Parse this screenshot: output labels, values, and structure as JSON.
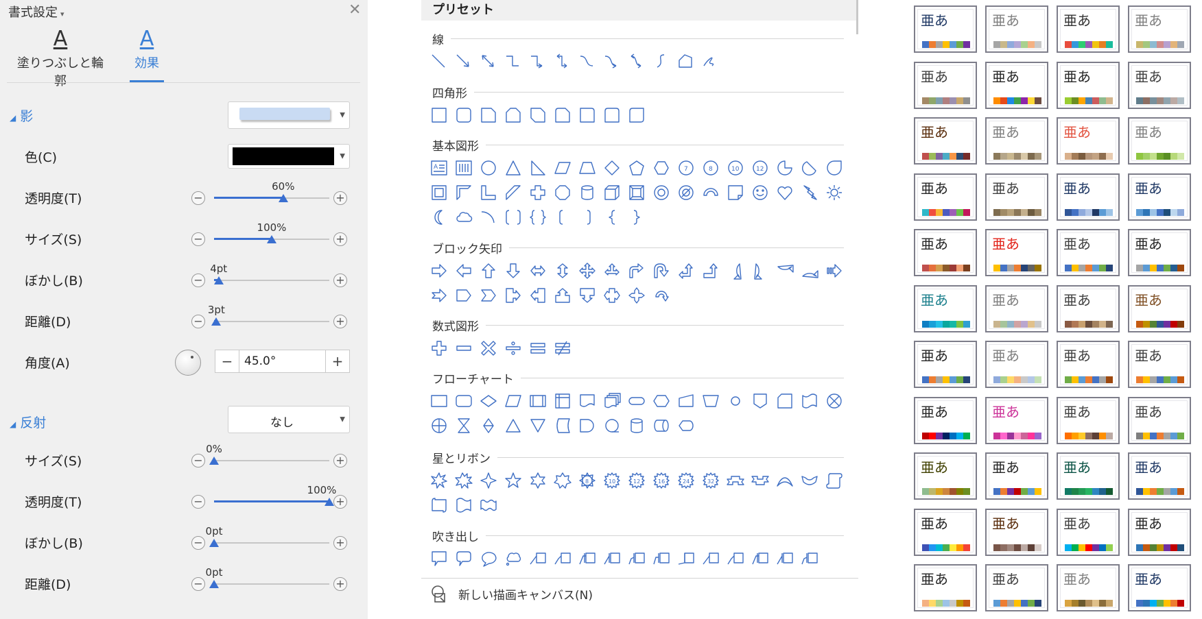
{
  "format_panel": {
    "title": "書式設定",
    "tabs": [
      {
        "icon": "A",
        "label": "塗りつぶしと輪郭"
      },
      {
        "icon": "A",
        "label": "効果"
      }
    ],
    "shadow": {
      "header": "影",
      "preset_color": "#c9dbf3",
      "color_label": "色(C)",
      "color_value": "#000000",
      "transparency": {
        "label": "透明度(T)",
        "value": "60%",
        "level": 0.6
      },
      "size": {
        "label": "サイズ(S)",
        "value": "100%",
        "level": 0.5
      },
      "blur": {
        "label": "ぼかし(B)",
        "value": "4pt",
        "level": 0.04
      },
      "distance": {
        "label": "距離(D)",
        "value": "3pt",
        "level": 0.02
      },
      "angle": {
        "label": "角度(A)",
        "value": "45.0°",
        "minus": "−",
        "plus": "+"
      }
    },
    "reflection": {
      "header": "反射",
      "preset_value": "なし",
      "size": {
        "label": "サイズ(S)",
        "value": "0%",
        "level": 0.0
      },
      "transparency": {
        "label": "透明度(T)",
        "value": "100%",
        "level": 1.0
      },
      "blur": {
        "label": "ぼかし(B)",
        "value": "0pt",
        "level": 0.0
      },
      "distance": {
        "label": "距離(D)",
        "value": "0pt",
        "level": 0.0
      }
    }
  },
  "preset": {
    "title": "プリセット",
    "categories": [
      {
        "label": "線",
        "count": 12
      },
      {
        "label": "四角形",
        "count": 9
      },
      {
        "label": "基本図形",
        "count": 43
      },
      {
        "label": "ブロック矢印",
        "count": 27
      },
      {
        "label": "数式図形",
        "count": 6
      },
      {
        "label": "フローチャート",
        "count": 28
      },
      {
        "label": "星とリボン",
        "count": 19
      },
      {
        "label": "吹き出し",
        "count": 16
      }
    ],
    "new_canvas": "新しい描画キャンバス(N)"
  },
  "themes": {
    "sample_text": "亜あ",
    "swatches": [
      {
        "text": "#1f3864",
        "colors": [
          "#4472c4",
          "#ed7d31",
          "#a5a5a5",
          "#ffc000",
          "#5b9bd5",
          "#70ad47",
          "#7030a0"
        ]
      },
      {
        "text": "#7f7f7f",
        "colors": [
          "#a5a5a5",
          "#c8b88a",
          "#8faadc",
          "#b4a7d6",
          "#a9d18e",
          "#f4b183",
          "#c9c9c9"
        ]
      },
      {
        "text": "#333333",
        "colors": [
          "#e84c3d",
          "#3498db",
          "#2ecc71",
          "#9b59b6",
          "#f1c40f",
          "#e67e22",
          "#1abc9c"
        ]
      },
      {
        "text": "#7f7f7f",
        "colors": [
          "#c9b76c",
          "#a3c77f",
          "#8dbad1",
          "#d28d8d",
          "#b7a1d0",
          "#e2b47a",
          "#9fa7b3"
        ]
      },
      {
        "text": "#404040",
        "colors": [
          "#a48966",
          "#8fa76a",
          "#7f9fb0",
          "#b07f7f",
          "#9b8fb0",
          "#c9a86b",
          "#8f8f8f"
        ]
      },
      {
        "text": "#262626",
        "colors": [
          "#ff8c00",
          "#e64a19",
          "#1e88e5",
          "#43a047",
          "#8e24aa",
          "#fdd835",
          "#6d4c41"
        ]
      },
      {
        "text": "#262626",
        "colors": [
          "#9acd32",
          "#6b8e23",
          "#ffa500",
          "#4682b4",
          "#cd5c5c",
          "#8fbc8f",
          "#d2b48c"
        ]
      },
      {
        "text": "#404040",
        "colors": [
          "#607d8b",
          "#8d6e63",
          "#78909c",
          "#a1887f",
          "#90a4ae",
          "#bcaaa4",
          "#b0bec5"
        ]
      },
      {
        "text": "#5a2d0c",
        "colors": [
          "#c0504d",
          "#9bbb59",
          "#8064a2",
          "#4bacc6",
          "#f79646",
          "#2c4d75",
          "#772c2a"
        ]
      },
      {
        "text": "#7f7f7f",
        "colors": [
          "#8c7a5b",
          "#b5a68a",
          "#c9b78f",
          "#9c8a6d",
          "#d8c8a8",
          "#7c6a4e",
          "#a8977a"
        ]
      },
      {
        "text": "#e2523f",
        "colors": [
          "#d9b08c",
          "#a37c58",
          "#7a5c3e",
          "#b6967a",
          "#c3a383",
          "#8e6e4f",
          "#e8cbb0"
        ]
      },
      {
        "text": "#7f7f7f",
        "colors": [
          "#8fc641",
          "#a3d068",
          "#c2e08b",
          "#70a62e",
          "#5a8f24",
          "#b7d97a",
          "#d1e8a9"
        ]
      },
      {
        "text": "#262626",
        "colors": [
          "#2eb8c9",
          "#f04e3e",
          "#f7b733",
          "#4b5bbf",
          "#9e5fb7",
          "#6cc24a",
          "#c2185b"
        ]
      },
      {
        "text": "#404040",
        "colors": [
          "#7d6b4e",
          "#a08b66",
          "#b7a17a",
          "#8a7657",
          "#c4b08d",
          "#6c5b40",
          "#988463"
        ]
      },
      {
        "text": "#1f3864",
        "colors": [
          "#2f5597",
          "#4472c4",
          "#8faadc",
          "#b4c7e7",
          "#203864",
          "#5b9bd5",
          "#9dc3e6"
        ]
      },
      {
        "text": "#1f3864",
        "colors": [
          "#5b9bd5",
          "#2e75b6",
          "#9dc3e6",
          "#4472c4",
          "#1f4e79",
          "#bdd7ee",
          "#8eaadb"
        ]
      },
      {
        "text": "#262626",
        "colors": [
          "#c0504d",
          "#e5703c",
          "#d39e4d",
          "#8b5a2b",
          "#9b3a36",
          "#f2a174",
          "#7a3f1e"
        ]
      },
      {
        "text": "#e2231a",
        "colors": [
          "#ffc000",
          "#4472c4",
          "#a5a5a5",
          "#ed7d31",
          "#264478",
          "#636363",
          "#997300"
        ]
      },
      {
        "text": "#404040",
        "colors": [
          "#4472c4",
          "#ffc000",
          "#a5a5a5",
          "#ed7d31",
          "#5b9bd5",
          "#70ad47",
          "#264478"
        ]
      },
      {
        "text": "#262626",
        "colors": [
          "#a5a5a5",
          "#5b9bd5",
          "#ffc000",
          "#4472c4",
          "#70ad47",
          "#255e91",
          "#9e480e"
        ]
      },
      {
        "text": "#1b7f8c",
        "colors": [
          "#0f7ec3",
          "#1aa0d8",
          "#24c0e6",
          "#0aa89e",
          "#15b8a6",
          "#7ec242",
          "#2f9fd1"
        ]
      },
      {
        "text": "#7f7f7f",
        "colors": [
          "#c9b48e",
          "#a6c49b",
          "#8fb4c9",
          "#d1a3a3",
          "#b9a6cf",
          "#e1c18b",
          "#c9c9c9"
        ]
      },
      {
        "text": "#404040",
        "colors": [
          "#8a5a44",
          "#b07855",
          "#c8a06e",
          "#6b4e3d",
          "#a48361",
          "#d1b38a",
          "#7e6753"
        ]
      },
      {
        "text": "#7f4f24",
        "colors": [
          "#c55a11",
          "#bf9000",
          "#548235",
          "#2f5597",
          "#7030a0",
          "#c00000",
          "#833c0b"
        ]
      },
      {
        "text": "#262626",
        "colors": [
          "#4472c4",
          "#ed7d31",
          "#a5a5a5",
          "#ffc000",
          "#5b9bd5",
          "#70ad47",
          "#264478"
        ]
      },
      {
        "text": "#7f7f7f",
        "colors": [
          "#8faadc",
          "#a9d18e",
          "#ffd966",
          "#f4b183",
          "#c9c9c9",
          "#b4c7e7",
          "#c5e0b4"
        ]
      },
      {
        "text": "#404040",
        "colors": [
          "#70ad47",
          "#ffc000",
          "#5b9bd5",
          "#ed7d31",
          "#4472c4",
          "#a5a5a5",
          "#9e480e"
        ]
      },
      {
        "text": "#404040",
        "colors": [
          "#ed7d31",
          "#ffc000",
          "#a5a5a5",
          "#4472c4",
          "#70ad47",
          "#5b9bd5",
          "#c55a11"
        ]
      },
      {
        "text": "#262626",
        "colors": [
          "#c00000",
          "#ff0000",
          "#7030a0",
          "#002060",
          "#0070c0",
          "#00b0f0",
          "#00b050"
        ]
      },
      {
        "text": "#cc3399",
        "colors": [
          "#cc3399",
          "#ff66cc",
          "#993399",
          "#ff99cc",
          "#cc6699",
          "#ff3399",
          "#9966cc"
        ]
      },
      {
        "text": "#404040",
        "colors": [
          "#ff6f00",
          "#ffa000",
          "#ffca28",
          "#8d6e63",
          "#5d4037",
          "#ff8f00",
          "#bcaaa4"
        ]
      },
      {
        "text": "#404040",
        "colors": [
          "#7f7f7f",
          "#ffc000",
          "#4472c4",
          "#ed7d31",
          "#a5a5a5",
          "#5b9bd5",
          "#70ad47"
        ]
      },
      {
        "text": "#404000",
        "colors": [
          "#8fbc8f",
          "#bdb76b",
          "#daa520",
          "#cd853f",
          "#a0522d",
          "#808000",
          "#6b8e23"
        ]
      },
      {
        "text": "#262626",
        "colors": [
          "#4472c4",
          "#ed7d31",
          "#7030a0",
          "#c00000",
          "#70ad47",
          "#5b9bd5",
          "#ffc000"
        ]
      },
      {
        "text": "#0b5345",
        "colors": [
          "#117a65",
          "#1e8449",
          "#239b56",
          "#28b463",
          "#2e86c1",
          "#1f618d",
          "#145a32"
        ]
      },
      {
        "text": "#1f3864",
        "colors": [
          "#2f5597",
          "#ffc000",
          "#ed7d31",
          "#70ad47",
          "#a5a5a5",
          "#5b9bd5",
          "#c55a11"
        ]
      },
      {
        "text": "#262626",
        "colors": [
          "#3f51b5",
          "#2196f3",
          "#00bcd4",
          "#4caf50",
          "#ffeb3b",
          "#ff9800",
          "#f44336"
        ]
      },
      {
        "text": "#5a2d0c",
        "colors": [
          "#795548",
          "#8d6e63",
          "#a1887f",
          "#6d4c41",
          "#bcaaa4",
          "#5d4037",
          "#d7ccc8"
        ]
      },
      {
        "text": "#404040",
        "colors": [
          "#00b0f0",
          "#00b050",
          "#ffc000",
          "#ff0000",
          "#7030a0",
          "#0070c0",
          "#92d050"
        ]
      },
      {
        "text": "#262626",
        "colors": [
          "#2e75b6",
          "#c55a11",
          "#548235",
          "#bf9000",
          "#7030a0",
          "#c00000",
          "#1f4e79"
        ]
      },
      {
        "text": "#262626",
        "colors": [
          "#f4b183",
          "#ffd966",
          "#a9d18e",
          "#9dc3e6",
          "#c9c9c9",
          "#bf9000",
          "#c55a11"
        ]
      },
      {
        "text": "#404040",
        "colors": [
          "#5b9bd5",
          "#ed7d31",
          "#a5a5a5",
          "#ffc000",
          "#4472c4",
          "#70ad47",
          "#264478"
        ]
      },
      {
        "text": "#7f7f7f",
        "colors": [
          "#d9a441",
          "#a57f2b",
          "#6b5a2e",
          "#b38f5a",
          "#e0c08a",
          "#8a6d3b",
          "#c9a66b"
        ]
      },
      {
        "text": "#1f3864",
        "colors": [
          "#4472c4",
          "#2e75b6",
          "#00b0f0",
          "#70ad47",
          "#ffc000",
          "#ed7d31",
          "#c00000"
        ]
      }
    ]
  }
}
